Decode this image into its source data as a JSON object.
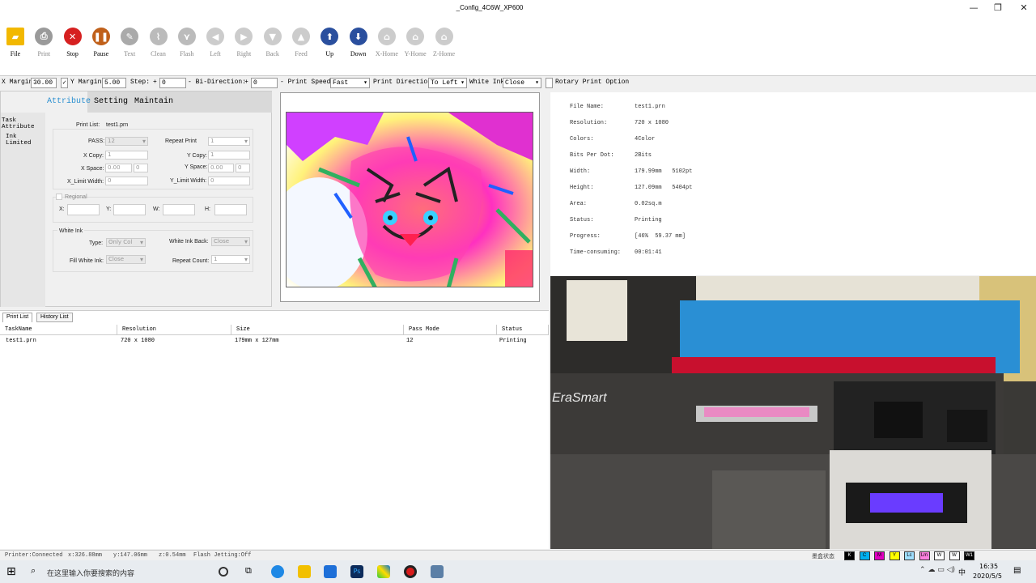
{
  "window": {
    "title": "_Config_4C6W_XP600",
    "min": "—",
    "max": "❐",
    "close": "✕"
  },
  "toolbar": [
    {
      "id": "file",
      "label": "File",
      "color": "#f2b800",
      "glyph": "▰",
      "enabled": true
    },
    {
      "id": "print",
      "label": "Print",
      "color": "#9a9a9a",
      "glyph": "⎙",
      "enabled": false
    },
    {
      "id": "stop",
      "label": "Stop",
      "color": "#d62020",
      "glyph": "✕",
      "enabled": true
    },
    {
      "id": "pause",
      "label": "Pause",
      "color": "#c0601a",
      "glyph": "❚❚",
      "enabled": true
    },
    {
      "id": "text",
      "label": "Text",
      "color": "#aaaaaa",
      "glyph": "✎",
      "enabled": false
    },
    {
      "id": "clean",
      "label": "Clean",
      "color": "#bbbbbb",
      "glyph": "⌇",
      "enabled": false
    },
    {
      "id": "flash",
      "label": "Flash",
      "color": "#bbbbbb",
      "glyph": "⋎",
      "enabled": false
    },
    {
      "id": "left",
      "label": "Left",
      "color": "#cccccc",
      "glyph": "◀",
      "enabled": false
    },
    {
      "id": "right",
      "label": "Right",
      "color": "#cccccc",
      "glyph": "▶",
      "enabled": false
    },
    {
      "id": "back",
      "label": "Back",
      "color": "#cccccc",
      "glyph": "▼",
      "enabled": false
    },
    {
      "id": "feed",
      "label": "Feed",
      "color": "#cccccc",
      "glyph": "▲",
      "enabled": false
    },
    {
      "id": "up",
      "label": "Up",
      "color": "#2a4f9e",
      "glyph": "⬆",
      "enabled": true
    },
    {
      "id": "down",
      "label": "Down",
      "color": "#2a4f9e",
      "glyph": "⬇",
      "enabled": true
    },
    {
      "id": "xhome",
      "label": "X-Home",
      "color": "#cccccc",
      "glyph": "⌂",
      "enabled": false
    },
    {
      "id": "yhome",
      "label": "Y-Home",
      "color": "#cccccc",
      "glyph": "⌂",
      "enabled": false
    },
    {
      "id": "zhome",
      "label": "Z-Home",
      "color": "#cccccc",
      "glyph": "⌂",
      "enabled": false
    }
  ],
  "options": {
    "x_margin_label": "X Margin",
    "x_margin": "30.00",
    "y_margin_label": "Y Margin",
    "y_margin": "5.00",
    "step_label": "Step:",
    "step_plus": "+",
    "step": "0",
    "bidir_label": "- Bi-Direction:",
    "bidir_plus": "+",
    "bidir": "0",
    "print_speed_label": "- Print Speed:",
    "print_speed": "Fast",
    "print_dir_label": "Print Direction:",
    "print_dir": "To Left",
    "white_ink_label": "White Ink",
    "white_ink": "Close",
    "rotary_label": "Rotary Print Option"
  },
  "left": {
    "tabs": [
      "Attribute",
      "Setting",
      "Maintain"
    ],
    "nav": [
      "Task Attribute",
      "Ink Limited"
    ],
    "print_list_label": "Print List:",
    "print_list_value": "test1.prn",
    "pass_label": "PASS:",
    "pass_value": "12",
    "repeat_print_label": "Repeat Print",
    "repeat_print_value": "1",
    "x_copy_label": "X Copy:",
    "x_copy_value": "1",
    "y_copy_label": "Y Copy:",
    "y_copy_value": "1",
    "x_space_label": "X Space:",
    "x_space_value": "0.00",
    "x_space_value2": "0",
    "y_space_label": "Y Space:",
    "y_space_value": "0.00",
    "y_space_value2": "0",
    "x_limit_label": "X_Limit Width:",
    "x_limit_value": "0",
    "y_limit_label": "Y_Limit Width:",
    "y_limit_value": "0",
    "regional_label": "Regional",
    "x_label": "X:",
    "y_label": "Y:",
    "w_label": "W:",
    "h_label": "H:",
    "white_ink_group": "White Ink",
    "type_label": "Type:",
    "type_value": "Only Col",
    "white_ink_back_label": "White Ink Back:",
    "white_ink_back_value": "Close",
    "fill_white_label": "Fill White Ink:",
    "fill_white_value": "Close",
    "repeat_count_label": "Repeat Count:",
    "repeat_count_value": "1"
  },
  "info": [
    {
      "k": "File Name:",
      "v": "test1.prn"
    },
    {
      "k": "Resolution:",
      "v": "720 x 1080"
    },
    {
      "k": "Colors:",
      "v": "4Color"
    },
    {
      "k": "Bits Per Dot:",
      "v": "2Bits"
    },
    {
      "k": "Width:",
      "v": "179.99mm   5102pt"
    },
    {
      "k": "Height:",
      "v": "127.09mm   5404pt"
    },
    {
      "k": "Area:",
      "v": "0.02sq.m"
    },
    {
      "k": "Status:",
      "v": "Printing"
    },
    {
      "k": "Progress:",
      "v": "[46%  59.37 mm]"
    },
    {
      "k": "Time-consuming:",
      "v": "00:01:41"
    }
  ],
  "photo": {
    "brand": "EraSmart"
  },
  "list": {
    "tabs": [
      "Print List",
      "History List"
    ],
    "columns": [
      "TaskName",
      "Resolution",
      "Size",
      "Pass Mode",
      "Status"
    ],
    "rows": [
      [
        "test1.prn",
        "720 x 1080",
        "179mm x 127mm",
        "12",
        "Printing"
      ]
    ]
  },
  "status": {
    "printer": "Printer:Connected",
    "x": "x:326.88mm",
    "y": "y:147.06mm",
    "z": "z:0.54mm",
    "flash": "Flash Jetting:Off",
    "ink_label": "墨盒状态",
    "inks": [
      {
        "t": "K",
        "bg": "#000000",
        "fg": "#ffffff"
      },
      {
        "t": "C",
        "bg": "#00b0f0",
        "fg": "#000000"
      },
      {
        "t": "M",
        "bg": "#e000c0",
        "fg": "#000000"
      },
      {
        "t": "Y",
        "bg": "#ffff00",
        "fg": "#000000"
      },
      {
        "t": "Lc",
        "bg": "#a0e0ff",
        "fg": "#000000"
      },
      {
        "t": "Lm",
        "bg": "#ff80e0",
        "fg": "#000000"
      },
      {
        "t": "W",
        "bg": "#ffffff",
        "fg": "#000000"
      },
      {
        "t": "W",
        "bg": "#ffffff",
        "fg": "#000000"
      },
      {
        "t": "W1",
        "bg": "#000000",
        "fg": "#ffffff"
      }
    ]
  },
  "taskbar": {
    "search": "在这里输入你要搜索的内容",
    "time": "16:35",
    "date": "2020/5/5",
    "lang": "中"
  }
}
